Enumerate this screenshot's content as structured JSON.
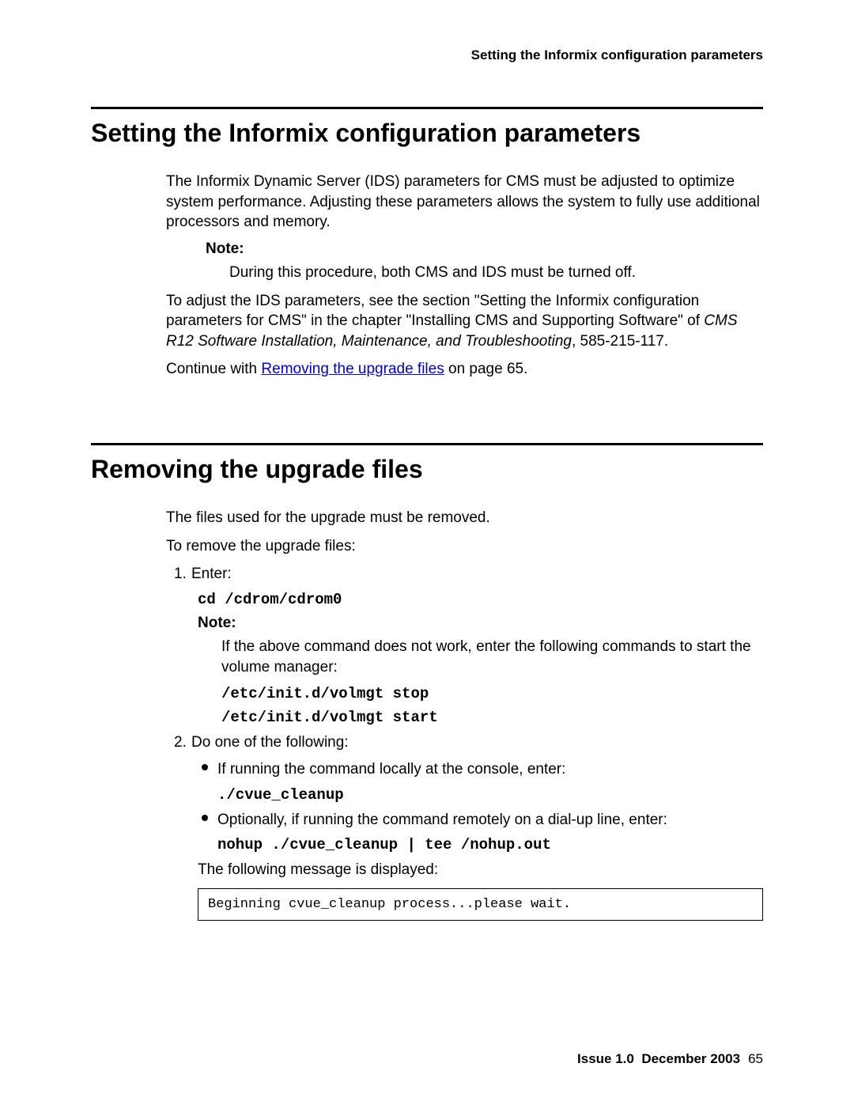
{
  "header": {
    "running_title": "Setting the Informix configuration parameters"
  },
  "section1": {
    "heading": "Setting the Informix configuration parameters",
    "para1": "The Informix Dynamic Server (IDS) parameters for CMS must be adjusted to optimize system performance. Adjusting these parameters allows the system to fully use additional processors and memory.",
    "note_label": "Note:",
    "note_text": "During this procedure, both CMS and IDS must be turned off.",
    "para2a": "To adjust the IDS parameters, see the section \"Setting the Informix configuration parameters for CMS\" in the chapter \"Installing CMS and Supporting Software\" of ",
    "para2b_italic": "CMS R12 Software Installation, Maintenance, and Troubleshooting",
    "para2c": ", 585-215-117.",
    "para3a": "Continue with ",
    "link_text": "Removing the upgrade files",
    "para3b": " on page 65."
  },
  "section2": {
    "heading": "Removing the upgrade files",
    "intro1": "The files used for the upgrade must be removed.",
    "intro2": "To remove the upgrade files:",
    "step1_label": "1.",
    "step1_text": "Enter:",
    "step1_cmd": "cd /cdrom/cdrom0",
    "step1_note_label": "Note:",
    "step1_note_text": "If the above command does not work, enter the following commands to start the volume manager:",
    "step1_cmd2": "/etc/init.d/volmgt stop",
    "step1_cmd3": "/etc/init.d/volmgt start",
    "step2_label": "2.",
    "step2_text": "Do one of the following:",
    "step2_bullet1": "If running the command locally at the console, enter:",
    "step2_bullet1_cmd": "./cvue_cleanup",
    "step2_bullet2": "Optionally, if running the command remotely on a dial-up line, enter:",
    "step2_bullet2_cmd": "nohup ./cvue_cleanup | tee /nohup.out",
    "step2_after": "The following message is displayed:",
    "output": "Beginning cvue_cleanup process...please wait."
  },
  "footer": {
    "issue": "Issue 1.0",
    "date": "December 2003",
    "page": "65"
  }
}
